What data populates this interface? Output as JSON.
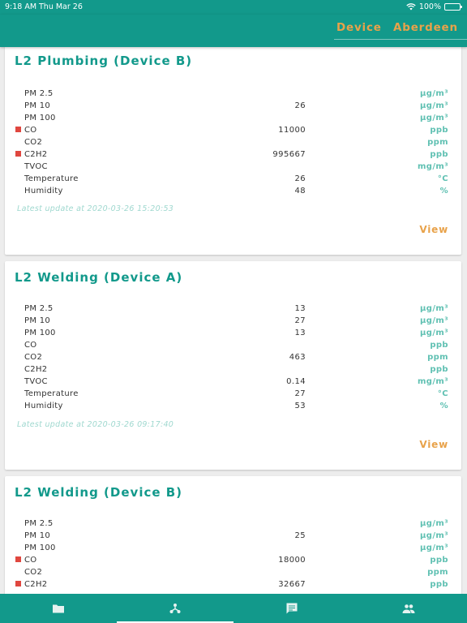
{
  "status_bar": {
    "time": "9:18 AM",
    "date": "Thu Mar 26",
    "battery": "100%"
  },
  "header": {
    "tab_device": "Device",
    "tab_location": "Aberdeen"
  },
  "labels": {
    "view": "View"
  },
  "cards": [
    {
      "title": "L2 Plumbing (Device B)",
      "updated": "Latest update at 2020-03-26 15:20:53",
      "rows": [
        {
          "label": "PM 2.5",
          "value": "",
          "unit": "µg/m³",
          "alarm": false
        },
        {
          "label": "PM 10",
          "value": "26",
          "unit": "µg/m³",
          "alarm": false
        },
        {
          "label": "PM 100",
          "value": "",
          "unit": "µg/m³",
          "alarm": false
        },
        {
          "label": "CO",
          "value": "11000",
          "unit": "ppb",
          "alarm": true
        },
        {
          "label": "CO2",
          "value": "",
          "unit": "ppm",
          "alarm": false
        },
        {
          "label": "C2H2",
          "value": "995667",
          "unit": "ppb",
          "alarm": true
        },
        {
          "label": "TVOC",
          "value": "",
          "unit": "mg/m³",
          "alarm": false
        },
        {
          "label": "Temperature",
          "value": "26",
          "unit": "°C",
          "alarm": false
        },
        {
          "label": "Humidity",
          "value": "48",
          "unit": "%",
          "alarm": false
        }
      ]
    },
    {
      "title": "L2 Welding (Device A)",
      "updated": "Latest update at 2020-03-26 09:17:40",
      "rows": [
        {
          "label": "PM 2.5",
          "value": "13",
          "unit": "µg/m³",
          "alarm": false
        },
        {
          "label": "PM 10",
          "value": "27",
          "unit": "µg/m³",
          "alarm": false
        },
        {
          "label": "PM 100",
          "value": "13",
          "unit": "µg/m³",
          "alarm": false
        },
        {
          "label": "CO",
          "value": "",
          "unit": "ppb",
          "alarm": false
        },
        {
          "label": "CO2",
          "value": "463",
          "unit": "ppm",
          "alarm": false
        },
        {
          "label": "C2H2",
          "value": "",
          "unit": "ppb",
          "alarm": false
        },
        {
          "label": "TVOC",
          "value": "0.14",
          "unit": "mg/m³",
          "alarm": false
        },
        {
          "label": "Temperature",
          "value": "27",
          "unit": "°C",
          "alarm": false
        },
        {
          "label": "Humidity",
          "value": "53",
          "unit": "%",
          "alarm": false
        }
      ]
    },
    {
      "title": "L2 Welding (Device B)",
      "updated": "",
      "rows": [
        {
          "label": "PM 2.5",
          "value": "",
          "unit": "µg/m³",
          "alarm": false
        },
        {
          "label": "PM 10",
          "value": "25",
          "unit": "µg/m³",
          "alarm": false
        },
        {
          "label": "PM 100",
          "value": "",
          "unit": "µg/m³",
          "alarm": false
        },
        {
          "label": "CO",
          "value": "18000",
          "unit": "ppb",
          "alarm": true
        },
        {
          "label": "CO2",
          "value": "",
          "unit": "ppm",
          "alarm": false
        },
        {
          "label": "C2H2",
          "value": "32667",
          "unit": "ppb",
          "alarm": true
        }
      ]
    }
  ],
  "bottom_nav": [
    {
      "icon": "folder-icon"
    },
    {
      "icon": "device-tree-icon"
    },
    {
      "icon": "message-icon"
    },
    {
      "icon": "people-icon"
    }
  ],
  "colors": {
    "primary": "#12998b",
    "accent": "#e8a24a",
    "alarm": "#e0473f",
    "unit": "#5fc0b2"
  }
}
